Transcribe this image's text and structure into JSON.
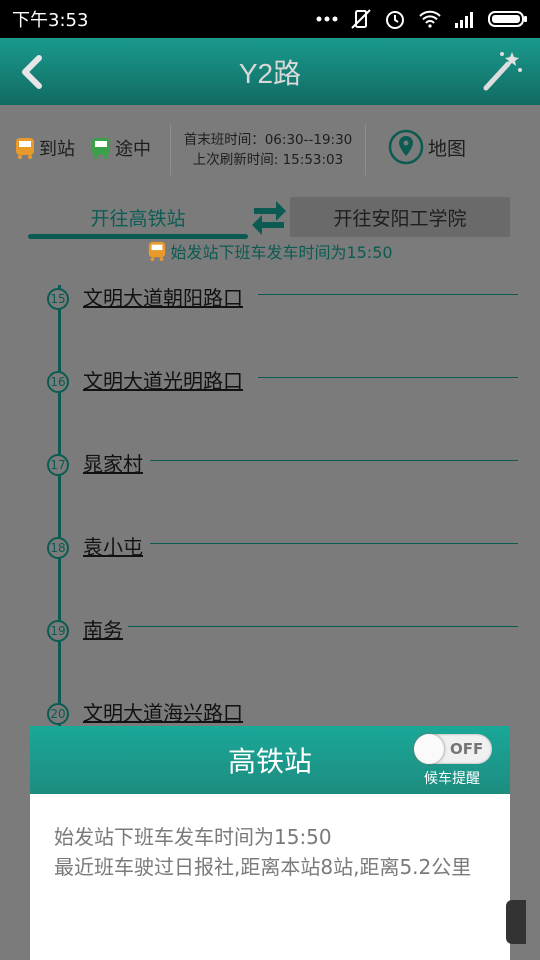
{
  "status_bar": {
    "time": "下午3:53"
  },
  "app_bar": {
    "title": "Y2路"
  },
  "legend": {
    "arrived_label": "到站",
    "en_route_label": "途中"
  },
  "schedule": {
    "first_last_label": "首末班时间：06:30--19:30",
    "last_refresh_label": "上次刷新时间: 15:53:03"
  },
  "map_button": {
    "label": "地图"
  },
  "direction_tabs": {
    "active_label": "开往高铁站",
    "inactive_label": "开往安阳工学院"
  },
  "notice": {
    "text": "始发站下班车发车时间为15:50"
  },
  "stops": [
    {
      "index": "15",
      "name": "文明大道朝阳路口"
    },
    {
      "index": "16",
      "name": "文明大道光明路口"
    },
    {
      "index": "17",
      "name": "晁家村"
    },
    {
      "index": "18",
      "name": "袁小屯"
    },
    {
      "index": "19",
      "name": "南务"
    },
    {
      "index": "20",
      "name": "文明大道海兴路口"
    }
  ],
  "dialog": {
    "title": "高铁站",
    "toggle_state": "OFF",
    "toggle_caption": "候车提醒",
    "line1": "始发站下班车发车时间为15:50",
    "line2": "最近班车驶过日报社,距离本站8站,距离5.2公里"
  },
  "colors": {
    "accent": "#1a9a8d",
    "accent_dark": "#0b5b53",
    "bus_orange": "#e89a2a",
    "bus_green": "#3aa14a"
  }
}
